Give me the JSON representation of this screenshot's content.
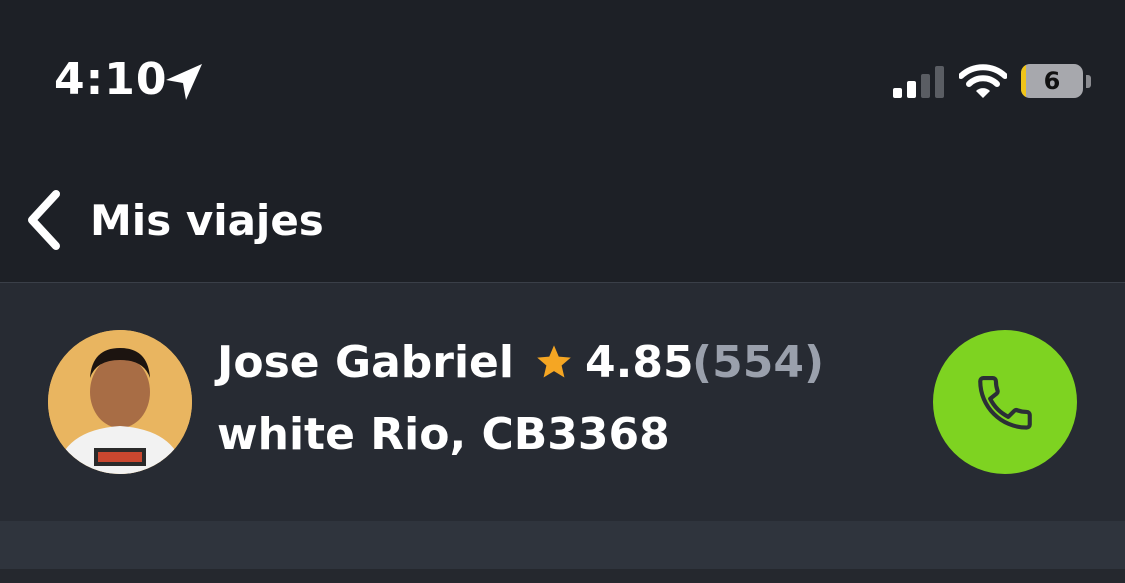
{
  "status_bar": {
    "time": "4:10",
    "battery_level": "6",
    "icons": [
      "location-arrow-icon",
      "cellular-signal-icon",
      "wifi-icon",
      "battery-icon"
    ]
  },
  "nav": {
    "back_label": "Mis viajes",
    "back_icon": "chevron-left-icon"
  },
  "driver": {
    "name": "Jose Gabriel",
    "rating": "4.85",
    "rating_count": "(554)",
    "vehicle": "white Rio, CB3368",
    "star_color": "#f5a623",
    "call_button_color": "#7ed321",
    "call_icon": "phone-icon"
  },
  "colors": {
    "background": "#1d2026",
    "card": "#272b33",
    "muted_text": "#9aa0ac"
  }
}
